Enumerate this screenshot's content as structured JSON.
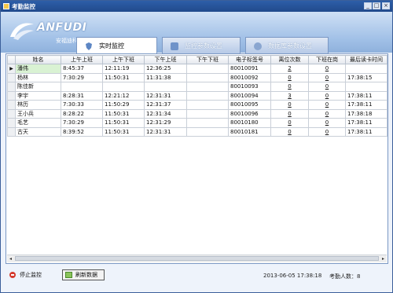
{
  "window": {
    "title": "考勤监控",
    "minimize": "_",
    "maximize": "□",
    "close": "×"
  },
  "logo": {
    "brand": "ANFUDI",
    "subtitle": "安福迪科技"
  },
  "tabs": [
    {
      "label": "实时监控",
      "active": true
    },
    {
      "label": "监控参数设置",
      "active": false
    },
    {
      "label": "数据库参数设置",
      "active": false
    }
  ],
  "table": {
    "columns": [
      "姓名",
      "上午上班",
      "上午下班",
      "下午上班",
      "下午下班",
      "电子标签号",
      "离位次数",
      "下班在岗",
      "最后读卡时间"
    ],
    "rows": [
      [
        "潘伟",
        "8:45:37",
        "12:11:19",
        "12:36:25",
        "",
        "80010091",
        "2",
        "0",
        ""
      ],
      [
        "杨林",
        "7:30:29",
        "11:50:31",
        "11:31:38",
        "",
        "80010092",
        "0",
        "0",
        "17:38:15"
      ],
      [
        "陈佳新",
        "",
        "",
        "",
        "",
        "80010093",
        "0",
        "0",
        ""
      ],
      [
        "李宇",
        "8:28:31",
        "12:21:12",
        "12:31:31",
        "",
        "80010094",
        "3",
        "0",
        "17:38:11"
      ],
      [
        "林历",
        "7:30:33",
        "11:50:29",
        "12:31:37",
        "",
        "80010095",
        "0",
        "0",
        "17:38:11"
      ],
      [
        "王小兵",
        "8:28:22",
        "11:50:31",
        "12:31:34",
        "",
        "80010096",
        "0",
        "0",
        "17:38:18"
      ],
      [
        "毛艺",
        "7:30:29",
        "11:50:31",
        "12:31:29",
        "",
        "80010180",
        "0",
        "0",
        "17:38:11"
      ],
      [
        "古天",
        "8:39:52",
        "11:50:31",
        "12:31:31",
        "",
        "80010181",
        "0",
        "0",
        "17:38:11"
      ]
    ],
    "row_pointer": "▶"
  },
  "footer": {
    "stop_label": "停止监控",
    "refresh_label": "刷新数据",
    "datetime": "2013-06-05 17:38:18",
    "count_label": "考勤人数：8"
  },
  "colors": {
    "accent": "#214a8c",
    "header": "#9fbfe6",
    "selected_name": "#d9f2d3"
  }
}
